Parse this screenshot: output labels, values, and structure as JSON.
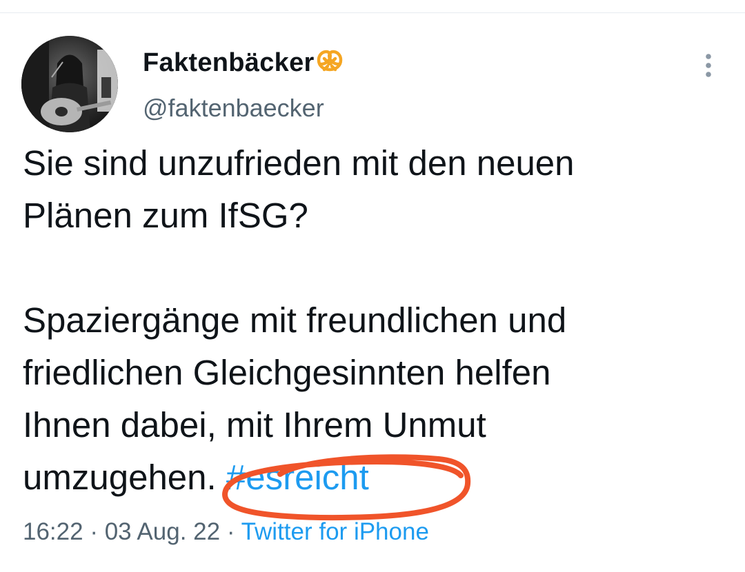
{
  "author": {
    "display_name": "Faktenbäcker",
    "badge_icon": "pretzel-icon",
    "handle": "@faktenbaecker"
  },
  "tweet": {
    "line1": "Sie sind unzufrieden mit den neuen",
    "line2": "Plänen zum IfSG?",
    "line3": "Spaziergänge mit freundlichen und",
    "line4": "friedlichen Gleichgesinnten helfen",
    "line5": "Ihnen dabei, mit Ihrem Unmut",
    "line6_text": "umzugehen. ",
    "hashtag": "#esreicht"
  },
  "meta": {
    "time": "16:22",
    "separator1": " · ",
    "date": "03 Aug. 22",
    "separator2": " · ",
    "source": "Twitter for iPhone"
  },
  "colors": {
    "text": "#0f1419",
    "secondary": "#536471",
    "link": "#1d9bf0",
    "annotation": "#f0542a",
    "pretzel": "#f5a623"
  }
}
